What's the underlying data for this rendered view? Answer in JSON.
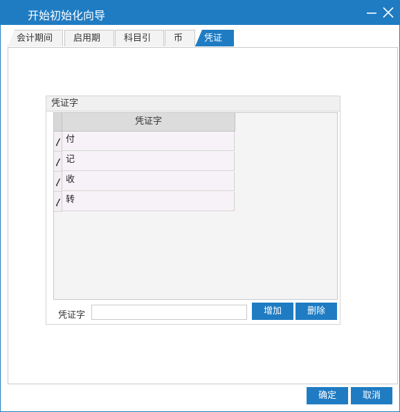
{
  "window": {
    "title": "开始初始化向导"
  },
  "tabs": [
    {
      "label": "会计期间"
    },
    {
      "label": "启用期间"
    },
    {
      "label": "科目引入"
    },
    {
      "label": "币别"
    },
    {
      "label": "凭证字"
    }
  ],
  "group": {
    "title": "凭证字"
  },
  "grid": {
    "column_header": "凭证字",
    "rows": [
      "付",
      "记",
      "收",
      "转"
    ]
  },
  "form": {
    "label": "凭证字",
    "value": "",
    "add_button": "增加",
    "delete_button": "删除"
  },
  "footer": {
    "ok_button": "确定",
    "cancel_button": "取消"
  },
  "colors": {
    "accent": "#1f7cc3",
    "row_bg": "#f7f2f7"
  },
  "icons": [
    "minimize-icon",
    "close-icon",
    "edit-pencil-icon"
  ]
}
